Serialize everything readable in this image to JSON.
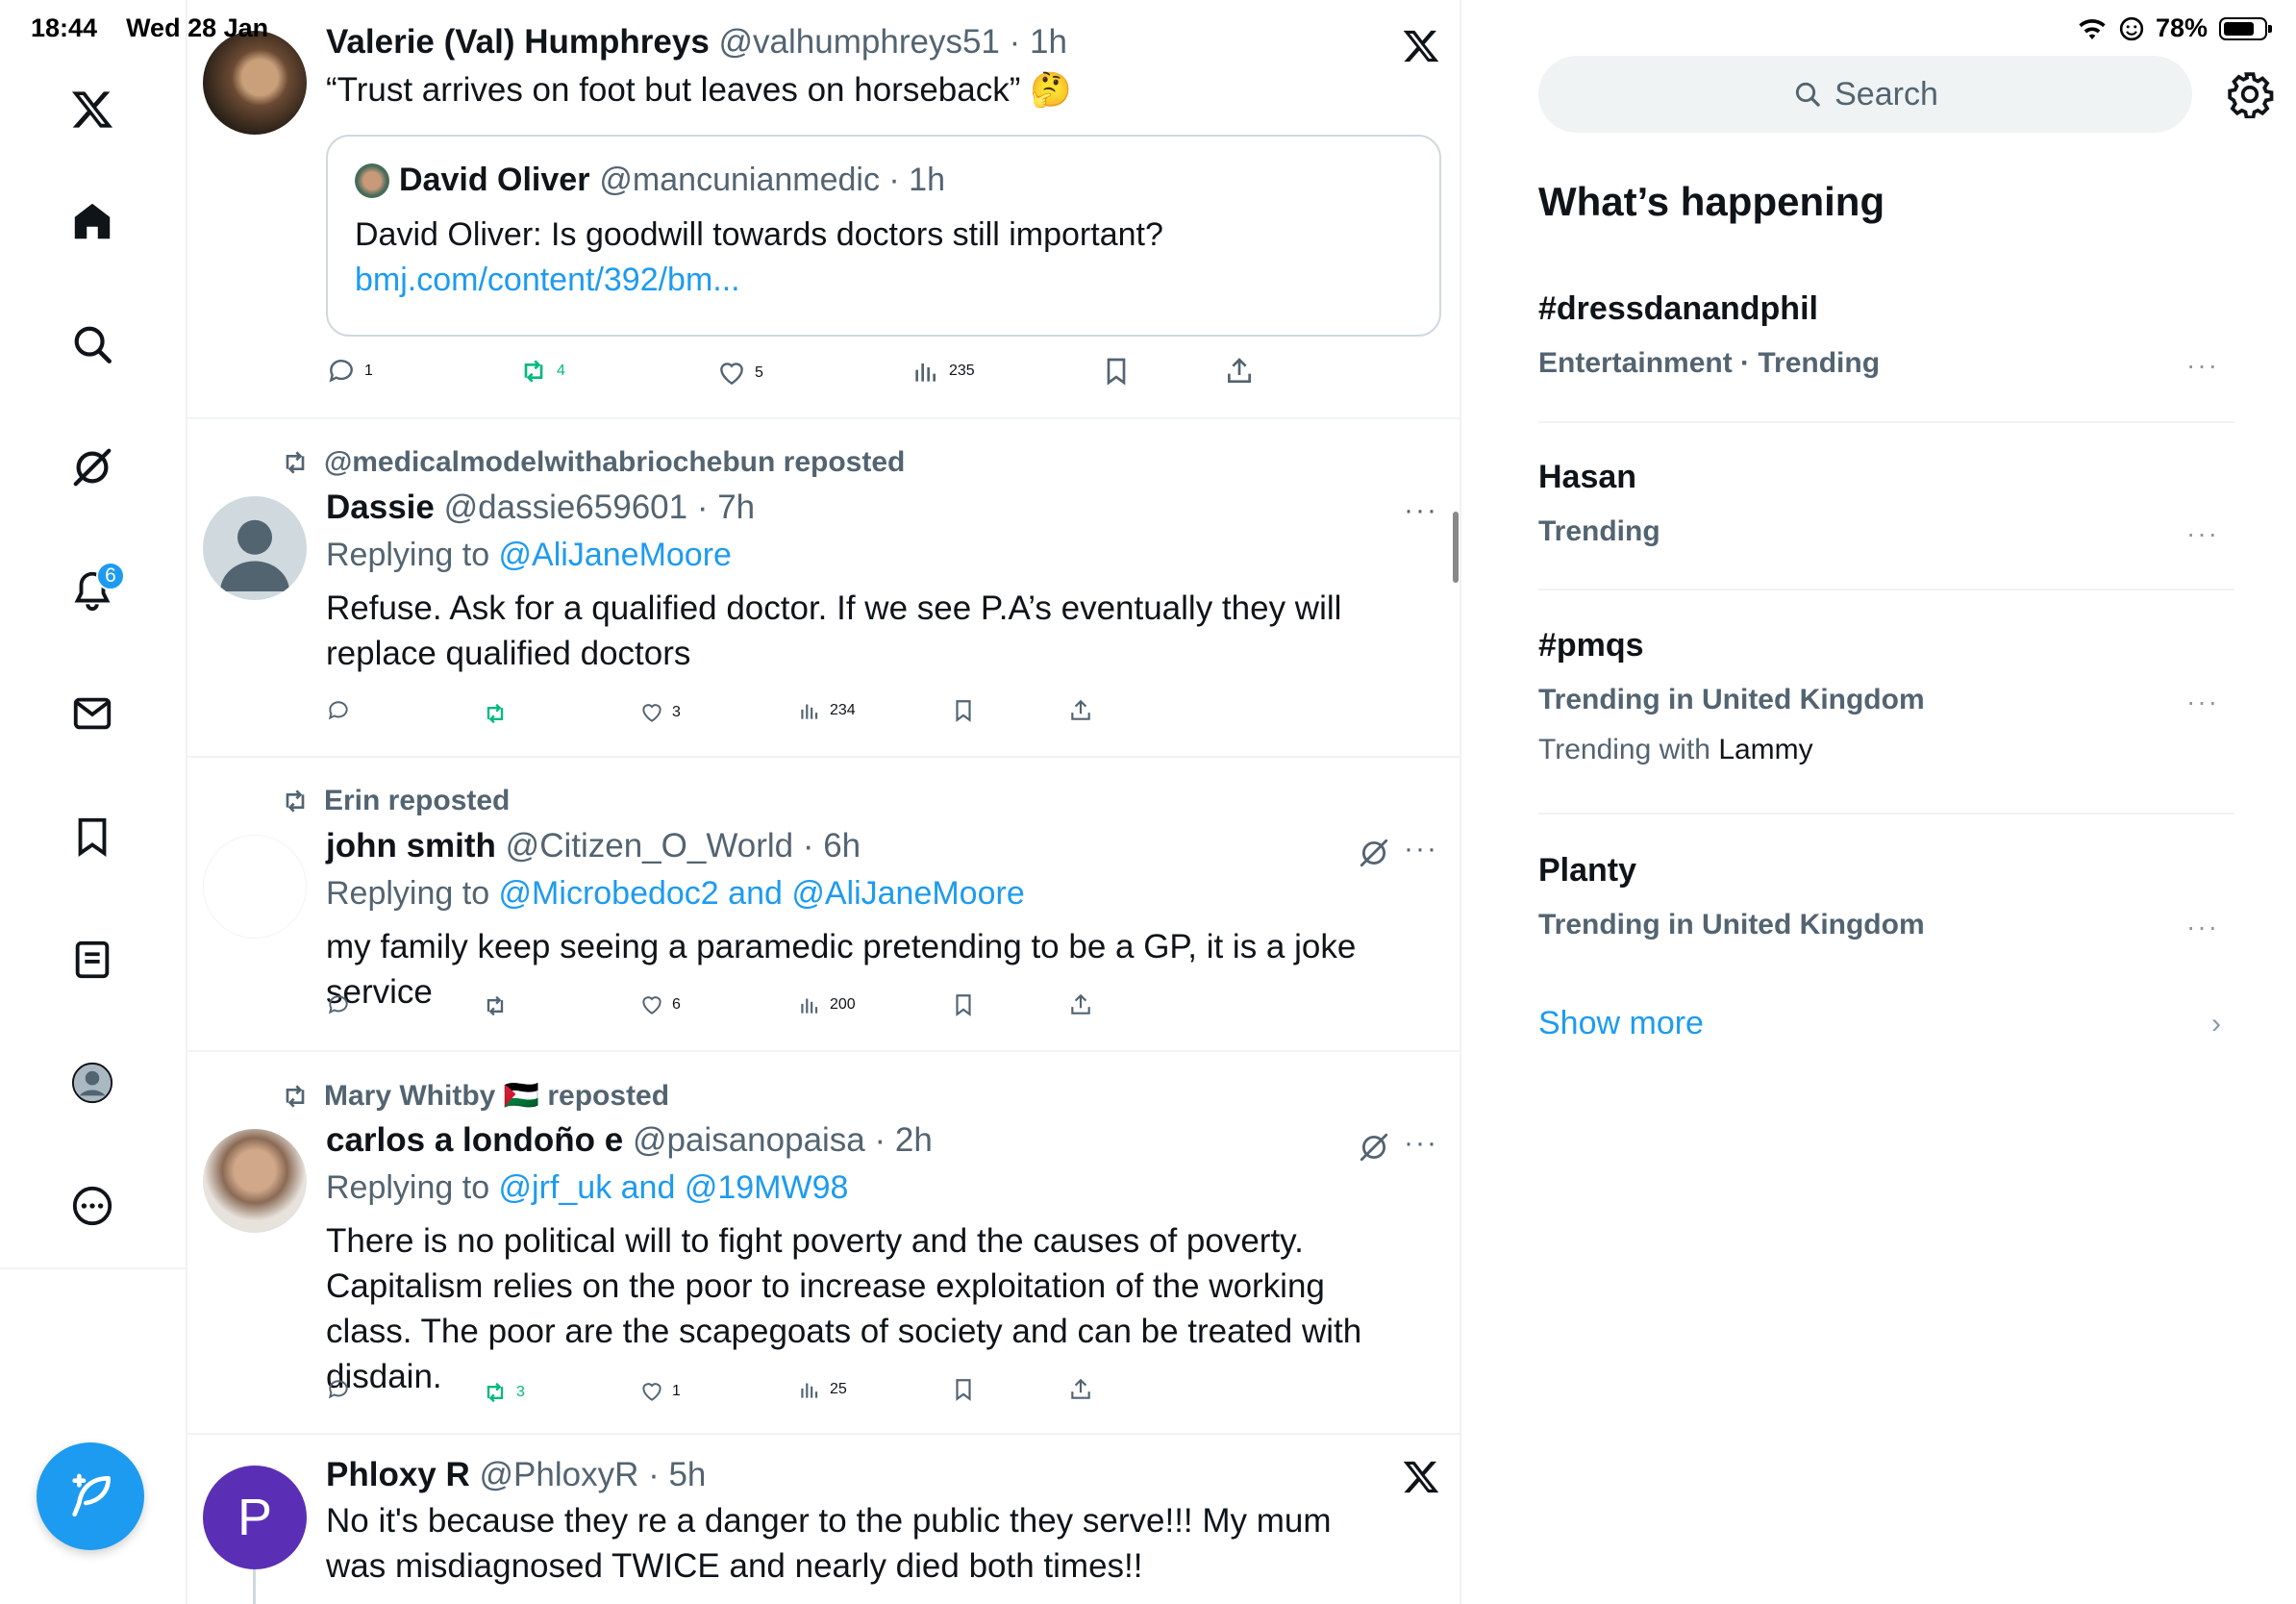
{
  "status_bar": {
    "time": "18:44",
    "date": "Wed 28 Jan",
    "battery": "78%"
  },
  "nav": {
    "items": [
      "X home logo",
      "Home",
      "Search",
      "Grok",
      "Notifications",
      "Messages",
      "Bookmarks",
      "Lists",
      "Profile",
      "More"
    ],
    "notification_count": "6"
  },
  "posts": [
    {
      "name": "Valerie (Val) Humphreys",
      "handle": "@valhumphreys51 · 1h",
      "text": "“Trust arrives on foot but leaves on horseback” 🤔",
      "quote": {
        "name": "David Oliver",
        "handle": "@mancunianmedic · 1h",
        "text": "David Oliver: Is goodwill towards doctors still important? ",
        "link": "bmj.com/content/392/bm..."
      },
      "replies": "1",
      "reposts": "4",
      "likes": "5",
      "views": "235"
    },
    {
      "reposted_by": "@medicalmodelwithabriochebun reposted",
      "name": "Dassie",
      "handle": "@dassie659601 · 7h",
      "replying_label": "Replying to ",
      "replying_to": "@AliJaneMoore",
      "text": "Refuse. Ask for a qualified doctor. If we see P.A’s eventually they will replace qualified doctors",
      "replies": "",
      "reposts": "",
      "likes": "3",
      "views": "234"
    },
    {
      "reposted_by": "Erin reposted",
      "name": "john smith",
      "handle": "@Citizen_O_World · 6h",
      "replying_label": "Replying to ",
      "replying_to": "@Microbedoc2 and @AliJaneMoore",
      "text": "my family keep seeing a paramedic pretending to be a GP, it is a joke service",
      "replies": "",
      "reposts": "",
      "likes": "6",
      "views": "200"
    },
    {
      "reposted_by": "Mary Whitby 🇵🇸 reposted",
      "name": "carlos a londoño e",
      "handle": "@paisanopaisa · 2h",
      "replying_label": "Replying to ",
      "replying_to": "@jrf_uk and @19MW98",
      "text": "There is no political will to fight poverty and the causes of poverty. Capitalism relies on the poor to increase exploitation of the working class. The poor are the scapegoats of society and can be treated with disdain.",
      "replies": "",
      "reposts": "3",
      "likes": "1",
      "views": "25"
    },
    {
      "name": "Phloxy R",
      "handle": "@PhloxyR · 5h",
      "avatar_letter": "P",
      "text": "No it's because they re a danger to the public they serve!!! My mum was misdiagnosed TWICE and nearly died both times!!"
    }
  ],
  "sidebar": {
    "search_placeholder": "Search",
    "title": "What’s happening",
    "trends": [
      {
        "name": "#dressdanandphil",
        "meta": "Entertainment · Trending"
      },
      {
        "name": "Hasan",
        "meta": "Trending"
      },
      {
        "name": "#pmqs",
        "meta": "Trending in United Kingdom",
        "with_label": "Trending with ",
        "with_value": "Lammy"
      },
      {
        "name": "Planty",
        "meta": "Trending in United Kingdom"
      }
    ],
    "show_more": "Show more"
  },
  "colors": {
    "accent": "#1d9bf0",
    "repost_green": "#00ba7c",
    "secondary_text": "#536471",
    "divider": "#eff3f4"
  }
}
